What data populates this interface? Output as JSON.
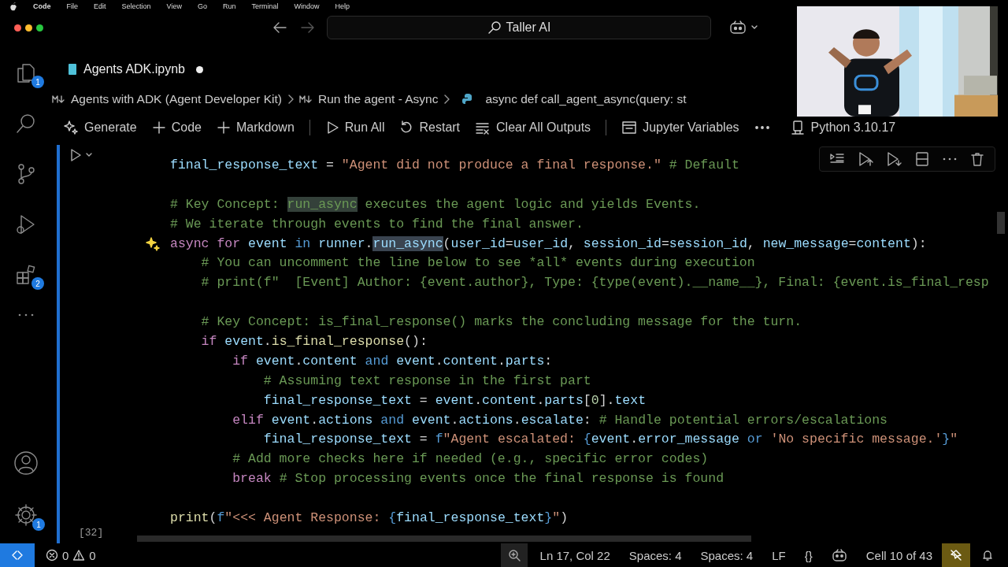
{
  "menu_bar": {
    "app_name": "Code",
    "items": [
      "File",
      "Edit",
      "Selection",
      "View",
      "Go",
      "Run",
      "Terminal",
      "Window",
      "Help"
    ]
  },
  "title_bar": {
    "command_center": "Taller AI"
  },
  "tab": {
    "label": "Agents ADK.ipynb",
    "dirty": true
  },
  "breadcrumb": [
    {
      "label": "Agents with ADK (Agent Developer Kit)",
      "kind": "markdown"
    },
    {
      "label": "Run the agent - Async",
      "kind": "markdown"
    },
    {
      "label": "async def call_agent_async(query: st",
      "kind": "python"
    }
  ],
  "toolbar": [
    {
      "label": "Generate",
      "kind": "sparkle"
    },
    {
      "label": "Code",
      "kind": "plus"
    },
    {
      "label": "Markdown",
      "kind": "plus"
    },
    {
      "kind": "separator"
    },
    {
      "label": "Run All",
      "kind": "run"
    },
    {
      "label": "Restart",
      "kind": "restart"
    },
    {
      "label": "Clear All Outputs",
      "kind": "clear"
    },
    {
      "kind": "separator"
    },
    {
      "label": "Jupyter Variables",
      "kind": "variables"
    },
    {
      "kind": "more"
    },
    {
      "label": "Python 3.10.17",
      "kind": "kernel"
    }
  ],
  "activity_bar": [
    {
      "kind": "files",
      "badge": "1"
    },
    {
      "kind": "search"
    },
    {
      "kind": "source-control"
    },
    {
      "kind": "debug"
    },
    {
      "kind": "extensions",
      "badge": "2"
    },
    {
      "kind": "more"
    },
    {
      "kind": "spacer"
    },
    {
      "kind": "account"
    },
    {
      "kind": "settings",
      "badge": "1"
    }
  ],
  "cell": {
    "execution_count": "[32]",
    "lines": [
      {
        "tokens": [
          {
            "text": "final_response_text",
            "kind": "var"
          },
          {
            "text": " = ",
            "kind": "plain"
          },
          {
            "text": "\"Agent did not produce a final response.\"",
            "kind": "string"
          },
          {
            "text": " # Default",
            "kind": "comment"
          }
        ]
      },
      {
        "space_before": true,
        "tokens": [
          {
            "text": "# Key Concept: ",
            "kind": "comment"
          },
          {
            "text": "run_async",
            "kind": "match"
          },
          {
            "text": " executes the agent logic and yields Events.",
            "kind": "comment"
          }
        ]
      },
      {
        "tokens": [
          {
            "text": "# We iterate through events to find the final answer.",
            "kind": "comment"
          }
        ]
      },
      {
        "ai_hint": true,
        "tokens": [
          {
            "text": "async for",
            "kind": "keyword"
          },
          {
            "text": " event",
            "kind": "var"
          },
          {
            "text": " in",
            "kind": "op"
          },
          {
            "text": " runner",
            "kind": "var"
          },
          {
            "text": ".",
            "kind": "plain"
          },
          {
            "text": "run_async",
            "kind": "selected"
          },
          {
            "text": "(",
            "kind": "plain"
          },
          {
            "text": "user_id",
            "kind": "var"
          },
          {
            "text": "=",
            "kind": "plain"
          },
          {
            "text": "user_id",
            "kind": "var"
          },
          {
            "text": ", ",
            "kind": "plain"
          },
          {
            "text": "session_id",
            "kind": "var"
          },
          {
            "text": "=",
            "kind": "plain"
          },
          {
            "text": "session_id",
            "kind": "var"
          },
          {
            "text": ", ",
            "kind": "plain"
          },
          {
            "text": "new_message",
            "kind": "var"
          },
          {
            "text": "=",
            "kind": "plain"
          },
          {
            "text": "content",
            "kind": "var"
          },
          {
            "text": "):",
            "kind": "plain"
          }
        ]
      },
      {
        "tokens": [
          {
            "text": "    # You can uncomment the line below to see *all* events during execution",
            "kind": "comment"
          }
        ]
      },
      {
        "tokens": [
          {
            "text": "    # print(f\"  [Event] Author: {event.author}, Type: {type(event).__name__}, Final: {event.is_final_resp",
            "kind": "comment"
          }
        ]
      },
      {
        "space_before": true,
        "tokens": [
          {
            "text": "    # Key Concept: is_final_response() marks the concluding message for the turn.",
            "kind": "comment"
          }
        ]
      },
      {
        "tokens": [
          {
            "text": "    if",
            "kind": "keyword"
          },
          {
            "text": " event",
            "kind": "var"
          },
          {
            "text": ".",
            "kind": "plain"
          },
          {
            "text": "is_final_response",
            "kind": "func"
          },
          {
            "text": "():",
            "kind": "plain"
          }
        ]
      },
      {
        "tokens": [
          {
            "text": "        if",
            "kind": "keyword"
          },
          {
            "text": " event",
            "kind": "var"
          },
          {
            "text": ".",
            "kind": "plain"
          },
          {
            "text": "content",
            "kind": "var"
          },
          {
            "text": " and",
            "kind": "op"
          },
          {
            "text": " event",
            "kind": "var"
          },
          {
            "text": ".",
            "kind": "plain"
          },
          {
            "text": "content",
            "kind": "var"
          },
          {
            "text": ".",
            "kind": "plain"
          },
          {
            "text": "parts",
            "kind": "var"
          },
          {
            "text": ":",
            "kind": "plain"
          }
        ]
      },
      {
        "tokens": [
          {
            "text": "            # Assuming text response in the first part",
            "kind": "comment"
          }
        ]
      },
      {
        "tokens": [
          {
            "text": "            final_response_text",
            "kind": "var"
          },
          {
            "text": " = ",
            "kind": "plain"
          },
          {
            "text": "event",
            "kind": "var"
          },
          {
            "text": ".",
            "kind": "plain"
          },
          {
            "text": "content",
            "kind": "var"
          },
          {
            "text": ".",
            "kind": "plain"
          },
          {
            "text": "parts",
            "kind": "var"
          },
          {
            "text": "[",
            "kind": "plain"
          },
          {
            "text": "0",
            "kind": "number"
          },
          {
            "text": "].",
            "kind": "plain"
          },
          {
            "text": "text",
            "kind": "var"
          }
        ]
      },
      {
        "tokens": [
          {
            "text": "        elif",
            "kind": "keyword"
          },
          {
            "text": " event",
            "kind": "var"
          },
          {
            "text": ".",
            "kind": "plain"
          },
          {
            "text": "actions",
            "kind": "var"
          },
          {
            "text": " and",
            "kind": "op"
          },
          {
            "text": " event",
            "kind": "var"
          },
          {
            "text": ".",
            "kind": "plain"
          },
          {
            "text": "actions",
            "kind": "var"
          },
          {
            "text": ".",
            "kind": "plain"
          },
          {
            "text": "escalate",
            "kind": "var"
          },
          {
            "text": ":",
            "kind": "plain"
          },
          {
            "text": " # Handle potential errors/escalations",
            "kind": "comment"
          }
        ]
      },
      {
        "tokens": [
          {
            "text": "            final_response_text",
            "kind": "var"
          },
          {
            "text": " = ",
            "kind": "plain"
          },
          {
            "text": "f",
            "kind": "op"
          },
          {
            "text": "\"Agent escalated: ",
            "kind": "string"
          },
          {
            "text": "{",
            "kind": "op"
          },
          {
            "text": "event",
            "kind": "var"
          },
          {
            "text": ".",
            "kind": "plain"
          },
          {
            "text": "error_message",
            "kind": "var"
          },
          {
            "text": " or",
            "kind": "op"
          },
          {
            "text": " 'No specific message.'",
            "kind": "string"
          },
          {
            "text": "}",
            "kind": "op"
          },
          {
            "text": "\"",
            "kind": "string"
          }
        ]
      },
      {
        "tokens": [
          {
            "text": "        # Add more checks here if needed (e.g., specific error codes)",
            "kind": "comment"
          }
        ]
      },
      {
        "tokens": [
          {
            "text": "        break",
            "kind": "keyword"
          },
          {
            "text": " # Stop processing events once the final response is found",
            "kind": "comment"
          }
        ]
      },
      {
        "space_before": true,
        "tokens": [
          {
            "text": "print",
            "kind": "func"
          },
          {
            "text": "(",
            "kind": "plain"
          },
          {
            "text": "f",
            "kind": "op"
          },
          {
            "text": "\"<<< Agent Response: ",
            "kind": "string"
          },
          {
            "text": "{",
            "kind": "op"
          },
          {
            "text": "final_response_text",
            "kind": "var"
          },
          {
            "text": "}",
            "kind": "op"
          },
          {
            "text": "\"",
            "kind": "string"
          },
          {
            "text": ")",
            "kind": "plain"
          }
        ]
      }
    ]
  },
  "status_bar": {
    "errors": "0",
    "warnings": "0",
    "items": [
      "Ln 17, Col 22",
      "Spaces: 4",
      "Spaces: 4",
      "LF",
      "{}"
    ],
    "cell_position": "Cell 10 of 43"
  }
}
